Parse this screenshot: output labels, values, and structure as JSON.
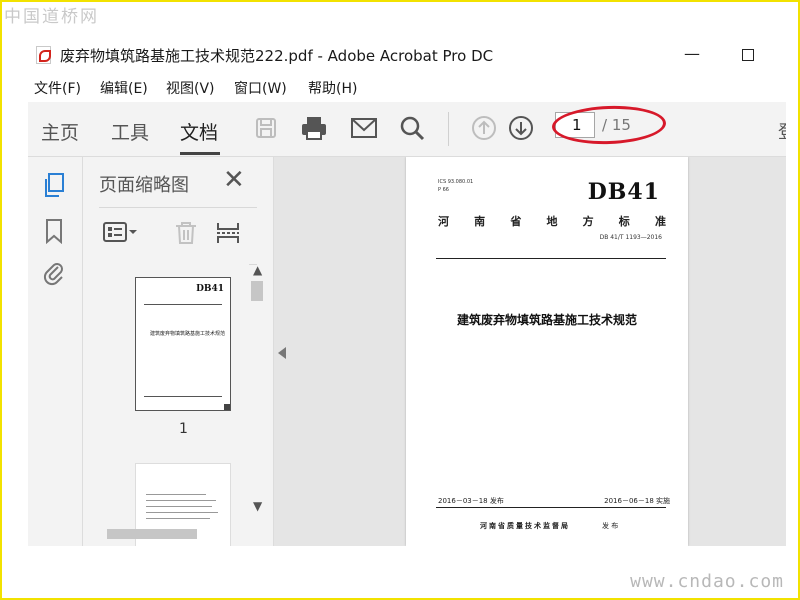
{
  "watermark": {
    "top": "中国道桥网",
    "bottom": "www.cndao.com"
  },
  "window": {
    "title": "废弃物填筑路基施工技术规范222.pdf - Adobe Acrobat Pro DC",
    "min_glyph": "—"
  },
  "menu": [
    {
      "label": "文件(F)"
    },
    {
      "label": "编辑(E)"
    },
    {
      "label": "视图(V)"
    },
    {
      "label": "窗口(W)"
    },
    {
      "label": "帮助(H)"
    }
  ],
  "tabs": {
    "home": "主页",
    "tools": "工具",
    "document": "文档"
  },
  "paging": {
    "current": "1",
    "total": "/ 15"
  },
  "toolbar_overflow": "登",
  "thumb_panel": {
    "title": "页面缩略图",
    "thumbs": [
      {
        "number": "1",
        "db": "DB41",
        "title": "建筑废弃物填筑路基施工技术规范"
      }
    ]
  },
  "document_page": {
    "ics": "ICS 93.080.01",
    "class": "P 66",
    "db": "DB41",
    "region": [
      "河",
      "南",
      "省",
      "地",
      "方",
      "标",
      "准"
    ],
    "std_no": "DB 41/T 1193—2016",
    "title": "建筑废弃物填筑路基施工技术规范",
    "issue_date": "2016－03－18 发布",
    "impl_date": "2016－06－18 实施",
    "publisher": "河南省质量技术监督局",
    "publish_word": "发 布"
  },
  "icons": [
    "pdf-icon",
    "save-icon",
    "print-icon",
    "email-icon",
    "search-icon",
    "page-up-icon",
    "page-down-icon",
    "pages-icon",
    "bookmark-icon",
    "attachment-icon",
    "close-icon",
    "options-icon",
    "delete-icon",
    "extract-icon"
  ],
  "colors": {
    "accent": "#2a7fd4",
    "annotation": "#d7192a",
    "frame": "#f2e200"
  }
}
